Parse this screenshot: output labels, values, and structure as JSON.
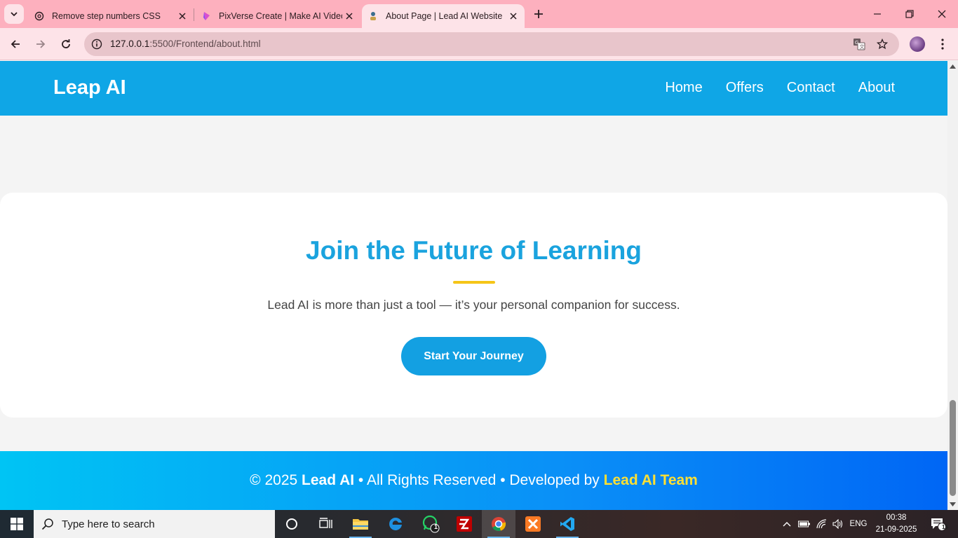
{
  "browser": {
    "tabs": [
      {
        "label": "Remove step numbers CSS",
        "icon": "openai-icon",
        "active": false
      },
      {
        "label": "PixVerse Create | Make AI Video",
        "icon": "pixverse-icon",
        "active": false
      },
      {
        "label": "About Page | Lead AI Website",
        "icon": "site-icon",
        "active": true
      }
    ],
    "url_host": "127.0.0.1",
    "url_rest": ":5500/Frontend/about.html"
  },
  "site": {
    "brand": "Leap AI",
    "nav": [
      "Home",
      "Offers",
      "Contact",
      "About"
    ],
    "cta": {
      "title": "Join the Future of Learning",
      "text": "Lead AI is more than just a tool — it’s your personal companion for success.",
      "button": "Start Your Journey"
    },
    "footer": {
      "prefix": "© 2025 ",
      "brand": "Lead AI",
      "middle": " • All Rights Reserved • Developed by ",
      "team": "Lead AI Team"
    },
    "colors": {
      "header": "#0fa6e6",
      "title": "#1aa3de",
      "accent_rule": "#f5c518",
      "footer_team": "#ffe033"
    }
  },
  "taskbar": {
    "search_placeholder": "Type here to search",
    "whatsapp_badge": "1",
    "language": "ENG",
    "time": "00:38",
    "date": "21-09-2025",
    "notifications": "15"
  }
}
